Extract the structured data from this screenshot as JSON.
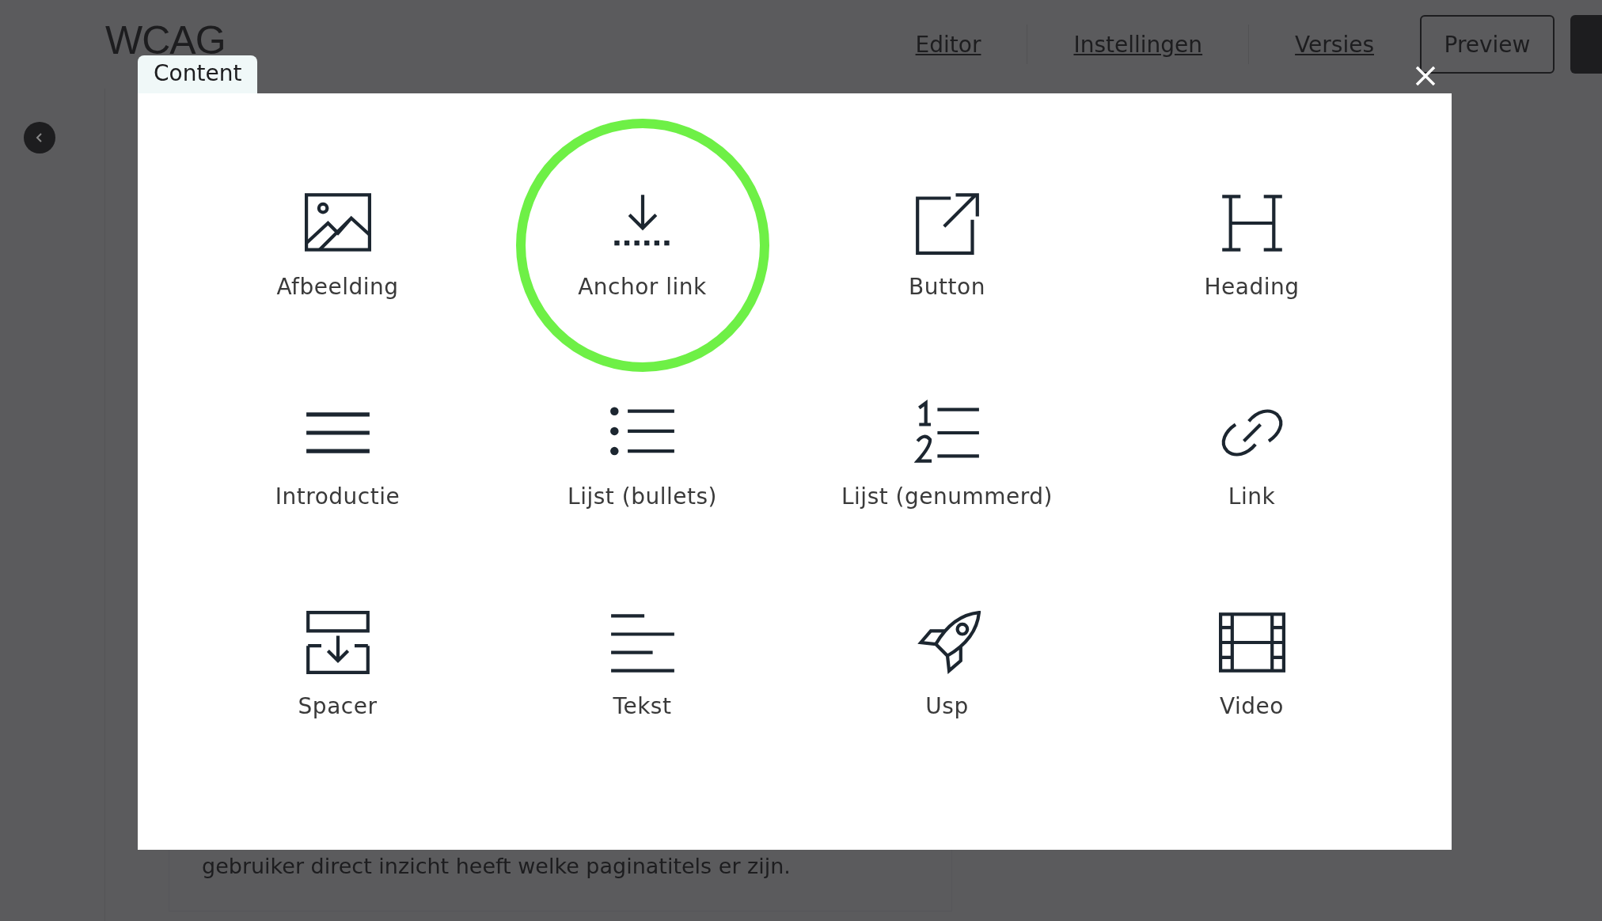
{
  "header": {
    "logo": "WCAG",
    "nav": [
      {
        "label": "Editor"
      },
      {
        "label": "Instellingen"
      },
      {
        "label": "Versies"
      }
    ],
    "preview_button": "Preview"
  },
  "background_text": "gebruiker direct inzicht heeft welke paginatitels er zijn.",
  "modal": {
    "tab": "Content",
    "items": [
      {
        "kind": "image",
        "label": "Afbeelding",
        "highlighted": false
      },
      {
        "kind": "anchor",
        "label": "Anchor link",
        "highlighted": true
      },
      {
        "kind": "button",
        "label": "Button",
        "highlighted": false
      },
      {
        "kind": "heading",
        "label": "Heading",
        "highlighted": false
      },
      {
        "kind": "intro",
        "label": "Introductie",
        "highlighted": false
      },
      {
        "kind": "bullets",
        "label": "Lijst (bullets)",
        "highlighted": false
      },
      {
        "kind": "numbered",
        "label": "Lijst (genummerd)",
        "highlighted": false
      },
      {
        "kind": "link",
        "label": "Link",
        "highlighted": false
      },
      {
        "kind": "spacer",
        "label": "Spacer",
        "highlighted": false
      },
      {
        "kind": "text",
        "label": "Tekst",
        "highlighted": false
      },
      {
        "kind": "usp",
        "label": "Usp",
        "highlighted": false
      },
      {
        "kind": "video",
        "label": "Video",
        "highlighted": false
      }
    ]
  }
}
